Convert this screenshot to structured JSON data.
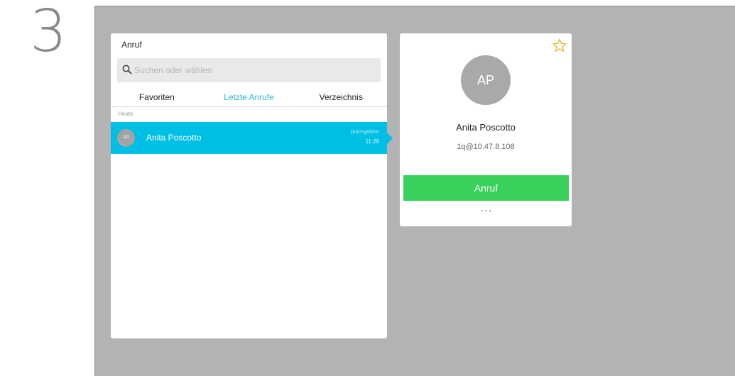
{
  "step": {
    "number": "3"
  },
  "call_panel": {
    "title": "Anruf",
    "search": {
      "placeholder": "Suchen oder wählen",
      "value": ""
    },
    "tabs": [
      {
        "label": "Favoriten",
        "active": false
      },
      {
        "label": "Letzte Anrufe",
        "active": true
      },
      {
        "label": "Verzeichnis",
        "active": false
      }
    ],
    "section_label": "Heute",
    "recent_calls": [
      {
        "initials": "AP",
        "name": "Anita Poscotto",
        "status": "Durchgeführt",
        "time": "11:28"
      }
    ]
  },
  "contact_card": {
    "initials": "AP",
    "name": "Anita Poscotto",
    "address": "1q@10.47.8.108",
    "call_label": "Anruf",
    "more_label": "···",
    "favorite_icon": "star-outline-icon"
  },
  "colors": {
    "accent": "#00bfe4",
    "call": "#39d05b",
    "star": "#f2b01e",
    "background": "#b3b3b3"
  }
}
